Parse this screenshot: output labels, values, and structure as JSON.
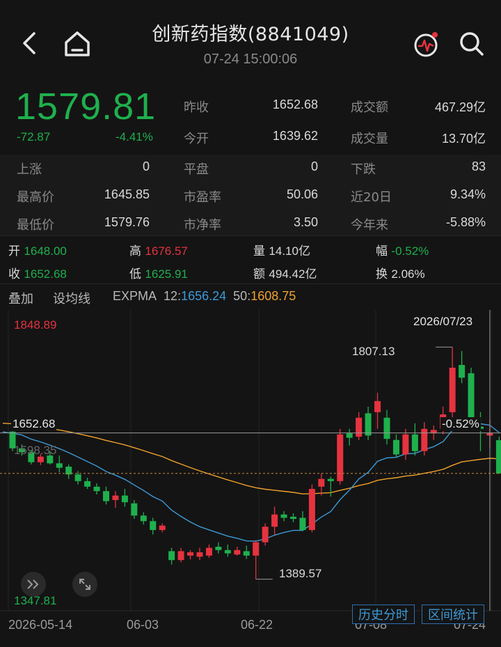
{
  "header": {
    "title": "创新药指数(8841049)",
    "datetime": "07-24 15:00:06"
  },
  "quote": {
    "price": "1579.81",
    "change": "-72.87",
    "change_pct": "-4.41%"
  },
  "stats": {
    "prev_close_label": "昨收",
    "prev_close": "1652.68",
    "open_label": "今开",
    "open": "1639.62",
    "turnover_label": "成交额",
    "turnover": "467.29亿",
    "volume_label": "成交量",
    "volume": "13.70亿",
    "up_label": "上涨",
    "up": "0",
    "flat_label": "平盘",
    "flat": "0",
    "down_label": "下跌",
    "down": "83",
    "high_label": "最高价",
    "high": "1645.85",
    "pe_label": "市盈率",
    "pe": "50.06",
    "d20_label": "近20日",
    "d20": "9.34%",
    "low_label": "最低价",
    "low": "1579.76",
    "pb_label": "市净率",
    "pb": "3.50",
    "ytd_label": "今年来",
    "ytd": "-5.88%"
  },
  "candle_info": {
    "open_label": "开",
    "open": "1648.00",
    "high_label": "高",
    "high": "1676.57",
    "vol_label": "量",
    "vol": "14.10亿",
    "amp_label": "幅",
    "amp": "-0.52%",
    "close_label": "收",
    "close": "1652.68",
    "low_label": "低",
    "low": "1625.91",
    "amount_label": "额",
    "amount": "494.42亿",
    "turn_label": "换",
    "turn": "2.06%"
  },
  "toolbar": {
    "overlay": "叠加",
    "set_ma": "设均线",
    "expma": "EXPMA",
    "ema12_label": "12:",
    "ema12": "1656.24",
    "ema50_label": "50:",
    "ema50": "1608.75"
  },
  "chart_labels": {
    "y_max": "1848.89",
    "y_min": "1347.81",
    "date_top": "2026/07/23",
    "marker_high": "1807.13",
    "marker_low": "1389.57",
    "ref_price": "1652.68",
    "ref_pct": "-0.52%",
    "mid_price": "1598.35",
    "x_ticks": [
      "2026-05-14",
      "06-03",
      "06-22",
      "07-08",
      "07-24"
    ],
    "history_btn": "历史分时",
    "range_btn": "区间统计"
  },
  "colors": {
    "up": "#e5333f",
    "down": "#1fb04d",
    "ema12": "#3d9ad6",
    "ema50": "#f0a12b"
  },
  "chart_data": {
    "type": "candlestick",
    "ylim": [
      1347.81,
      1848.89
    ],
    "candles": [
      {
        "o": 1655,
        "h": 1668,
        "l": 1620,
        "c": 1625
      },
      {
        "o": 1625,
        "h": 1632,
        "l": 1612,
        "c": 1618
      },
      {
        "o": 1618,
        "h": 1622,
        "l": 1596,
        "c": 1600
      },
      {
        "o": 1600,
        "h": 1615,
        "l": 1595,
        "c": 1610
      },
      {
        "o": 1612,
        "h": 1620,
        "l": 1596,
        "c": 1598
      },
      {
        "o": 1598,
        "h": 1612,
        "l": 1582,
        "c": 1590
      },
      {
        "o": 1592,
        "h": 1596,
        "l": 1570,
        "c": 1578
      },
      {
        "o": 1578,
        "h": 1584,
        "l": 1560,
        "c": 1566
      },
      {
        "o": 1566,
        "h": 1572,
        "l": 1552,
        "c": 1556
      },
      {
        "o": 1556,
        "h": 1562,
        "l": 1542,
        "c": 1548
      },
      {
        "o": 1548,
        "h": 1556,
        "l": 1524,
        "c": 1530
      },
      {
        "o": 1532,
        "h": 1548,
        "l": 1518,
        "c": 1540
      },
      {
        "o": 1540,
        "h": 1552,
        "l": 1520,
        "c": 1528
      },
      {
        "o": 1526,
        "h": 1532,
        "l": 1498,
        "c": 1504
      },
      {
        "o": 1504,
        "h": 1510,
        "l": 1488,
        "c": 1494
      },
      {
        "o": 1494,
        "h": 1500,
        "l": 1470,
        "c": 1478
      },
      {
        "o": 1478,
        "h": 1490,
        "l": 1474,
        "c": 1486
      },
      {
        "o": 1440,
        "h": 1446,
        "l": 1416,
        "c": 1424
      },
      {
        "o": 1424,
        "h": 1446,
        "l": 1420,
        "c": 1440
      },
      {
        "o": 1432,
        "h": 1442,
        "l": 1425,
        "c": 1438
      },
      {
        "o": 1430,
        "h": 1446,
        "l": 1424,
        "c": 1438
      },
      {
        "o": 1432,
        "h": 1452,
        "l": 1428,
        "c": 1446
      },
      {
        "o": 1448,
        "h": 1456,
        "l": 1436,
        "c": 1442
      },
      {
        "o": 1442,
        "h": 1452,
        "l": 1430,
        "c": 1436
      },
      {
        "o": 1434,
        "h": 1448,
        "l": 1432,
        "c": 1442
      },
      {
        "o": 1440,
        "h": 1450,
        "l": 1426,
        "c": 1432
      },
      {
        "o": 1432,
        "h": 1460,
        "l": 1389.57,
        "c": 1456
      },
      {
        "o": 1456,
        "h": 1490,
        "l": 1450,
        "c": 1484
      },
      {
        "o": 1484,
        "h": 1520,
        "l": 1470,
        "c": 1506
      },
      {
        "o": 1506,
        "h": 1512,
        "l": 1494,
        "c": 1500
      },
      {
        "o": 1502,
        "h": 1508,
        "l": 1492,
        "c": 1498
      },
      {
        "o": 1500,
        "h": 1512,
        "l": 1476,
        "c": 1478
      },
      {
        "o": 1478,
        "h": 1560,
        "l": 1474,
        "c": 1552
      },
      {
        "o": 1556,
        "h": 1580,
        "l": 1540,
        "c": 1570
      },
      {
        "o": 1570,
        "h": 1574,
        "l": 1538,
        "c": 1566
      },
      {
        "o": 1566,
        "h": 1660,
        "l": 1560,
        "c": 1650
      },
      {
        "o": 1652,
        "h": 1660,
        "l": 1630,
        "c": 1644
      },
      {
        "o": 1646,
        "h": 1690,
        "l": 1640,
        "c": 1680
      },
      {
        "o": 1688,
        "h": 1700,
        "l": 1640,
        "c": 1648
      },
      {
        "o": 1690,
        "h": 1725,
        "l": 1660,
        "c": 1710
      },
      {
        "o": 1680,
        "h": 1694,
        "l": 1632,
        "c": 1642
      },
      {
        "o": 1640,
        "h": 1650,
        "l": 1608,
        "c": 1614
      },
      {
        "o": 1614,
        "h": 1660,
        "l": 1604,
        "c": 1650
      },
      {
        "o": 1650,
        "h": 1670,
        "l": 1612,
        "c": 1620
      },
      {
        "o": 1620,
        "h": 1672,
        "l": 1612,
        "c": 1660
      },
      {
        "o": 1652,
        "h": 1666,
        "l": 1640,
        "c": 1658
      },
      {
        "o": 1660,
        "h": 1700,
        "l": 1650,
        "c": 1686
      },
      {
        "o": 1690,
        "h": 1807.13,
        "l": 1680,
        "c": 1770
      },
      {
        "o": 1775,
        "h": 1800,
        "l": 1742,
        "c": 1752
      },
      {
        "o": 1760,
        "h": 1770,
        "l": 1656,
        "c": 1664
      },
      {
        "o": 1664,
        "h": 1690,
        "l": 1620,
        "c": 1660
      },
      {
        "o": 1648,
        "h": 1676.57,
        "l": 1625.91,
        "c": 1652.68
      },
      {
        "o": 1639.62,
        "h": 1645.85,
        "l": 1579.76,
        "c": 1579.81
      }
    ]
  }
}
